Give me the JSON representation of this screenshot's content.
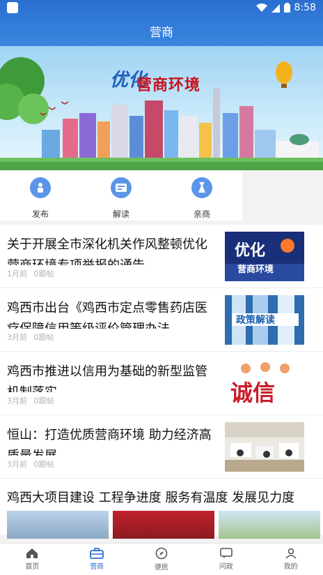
{
  "status_bar": {
    "time": "8:58"
  },
  "header": {
    "title": "营商"
  },
  "banner": {
    "line1": "优化",
    "line2": "营商环境"
  },
  "quick_actions": [
    {
      "label": "发布",
      "icon": "publish-icon"
    },
    {
      "label": "解读",
      "icon": "interpret-icon"
    },
    {
      "label": "亲商",
      "icon": "pro-business-icon"
    }
  ],
  "news": [
    {
      "title": "关于开展全市深化机关作风整顿优化营商环境专项举报的通告",
      "time": "1月前",
      "followups": "0跟帖",
      "thumb_text": "优化 营商环境"
    },
    {
      "title": "鸡西市出台《鸡西市定点零售药店医疗保障信用等级评价管理办法",
      "time": "3月前",
      "followups": "0跟帖",
      "thumb_text": "政策解读"
    },
    {
      "title": "鸡西市推进以信用为基础的新型监管机制落实",
      "time": "3月前",
      "followups": "0跟帖",
      "thumb_text": "诚信"
    },
    {
      "title": "恒山：打造优质营商环境 助力经济高质量发展",
      "time": "3月前",
      "followups": "0跟帖",
      "thumb_text": ""
    }
  ],
  "featured": {
    "title": "鸡西大项目建设 工程争进度 服务有温度 发展见力度"
  },
  "bottom_nav": [
    {
      "label": "首页",
      "icon": "home-icon",
      "active": false
    },
    {
      "label": "营商",
      "icon": "briefcase-icon",
      "active": true
    },
    {
      "label": "便民",
      "icon": "compass-icon",
      "active": false
    },
    {
      "label": "问政",
      "icon": "chat-icon",
      "active": false
    },
    {
      "label": "我的",
      "icon": "person-icon",
      "active": false
    }
  ],
  "colors": {
    "primary": "#2a6fd0",
    "accent_red": "#c8121e"
  }
}
